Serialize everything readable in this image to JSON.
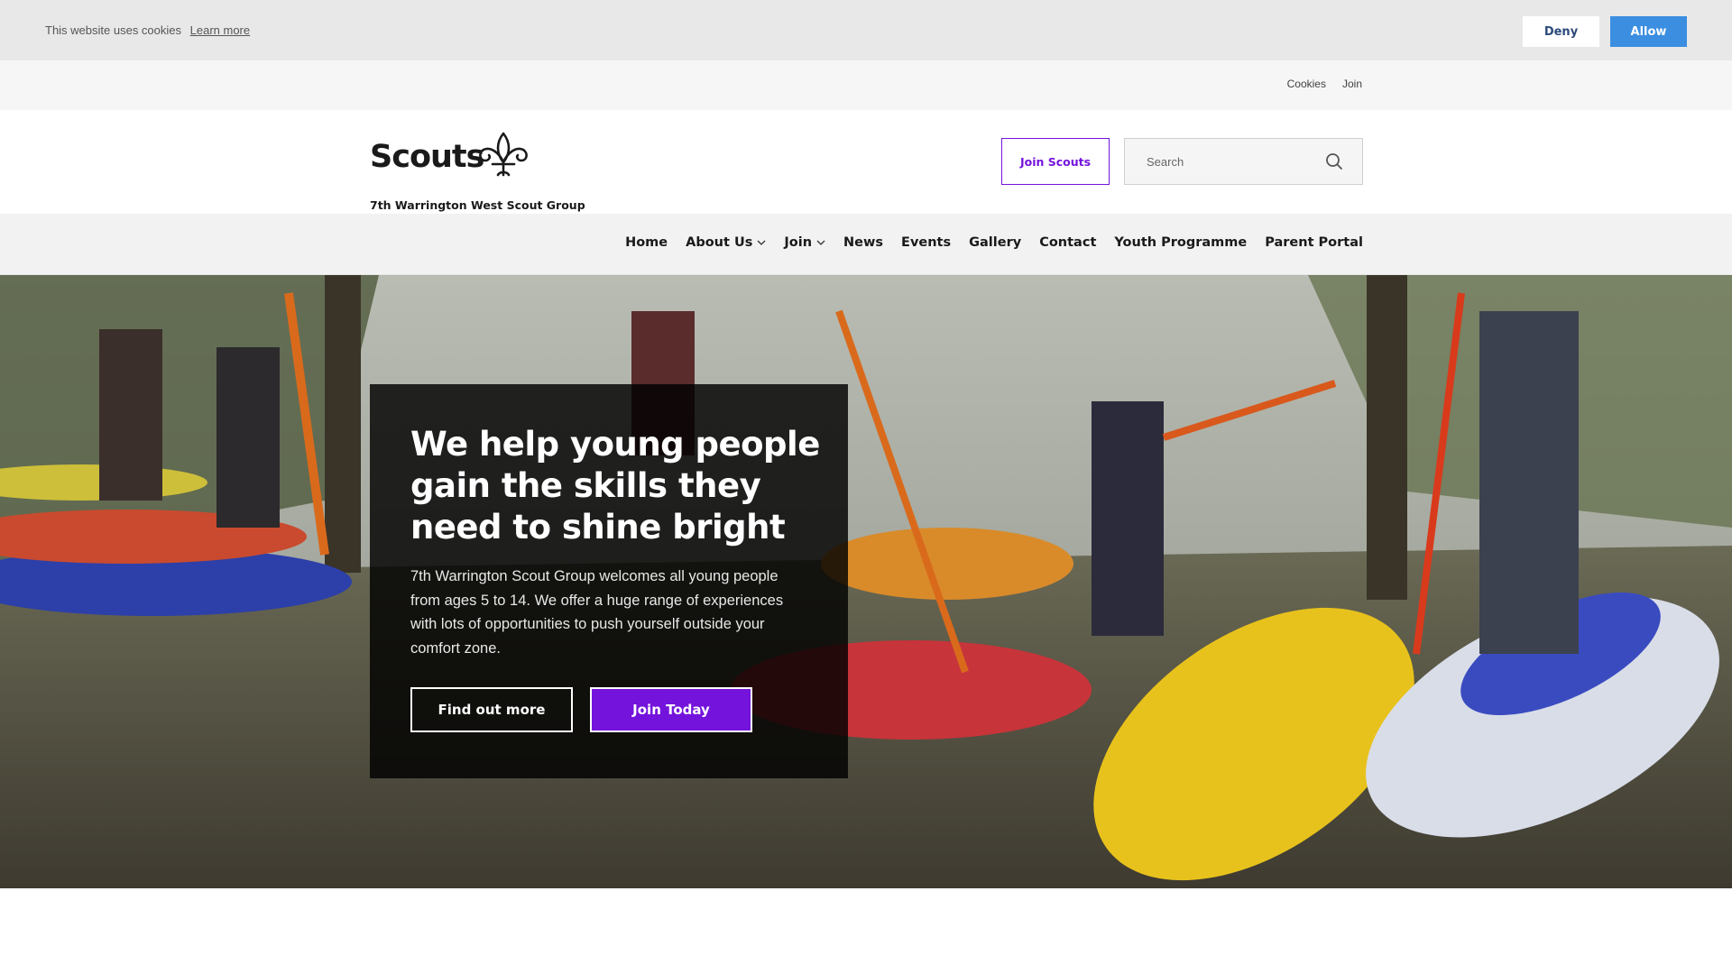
{
  "cookie_banner": {
    "message": "This website uses cookies",
    "learn_more": "Learn more",
    "deny_label": "Deny",
    "allow_label": "Allow"
  },
  "utility_nav": {
    "items": [
      "Cookies",
      "Join"
    ]
  },
  "header": {
    "logo_word": "Scouts",
    "logo_subtitle": "7th Warrington West Scout Group",
    "join_button": "Join Scouts",
    "search": {
      "placeholder": "Search",
      "icon": "search-icon"
    }
  },
  "main_nav": {
    "items": [
      {
        "label": "Home",
        "has_dropdown": false
      },
      {
        "label": "About Us",
        "has_dropdown": true
      },
      {
        "label": "Join",
        "has_dropdown": true
      },
      {
        "label": "News",
        "has_dropdown": false
      },
      {
        "label": "Events",
        "has_dropdown": false
      },
      {
        "label": "Gallery",
        "has_dropdown": false
      },
      {
        "label": "Contact",
        "has_dropdown": false
      },
      {
        "label": "Youth Programme",
        "has_dropdown": false
      },
      {
        "label": "Parent Portal",
        "has_dropdown": false
      }
    ]
  },
  "hero": {
    "title": "We help young people gain the skills they need to shine bright",
    "body": "7th Warrington Scout Group welcomes all young people from ages 5 to 14. We offer a huge range of experiences with lots of opportunities to push yourself outside your comfort zone.",
    "primary_button": "Find out more",
    "secondary_button": "Join Today"
  },
  "colors": {
    "brand_purple": "#7413dc",
    "cookie_allow_blue": "#3b8ee0",
    "cookie_bar_bg": "#e8e8e8"
  }
}
